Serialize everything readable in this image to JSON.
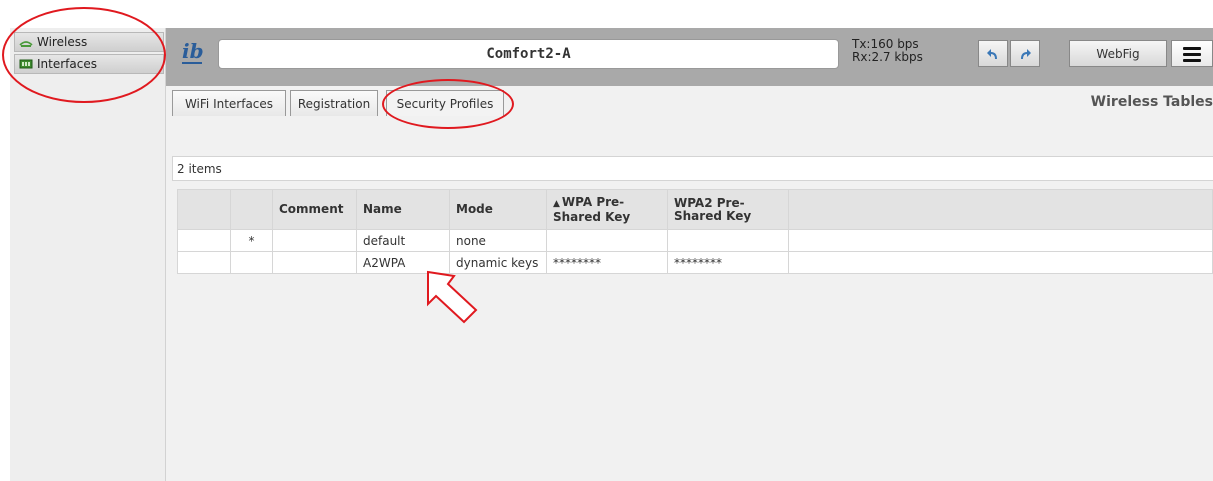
{
  "sidebar": {
    "items": [
      {
        "label": "Wireless",
        "icon": "wifi-icon"
      },
      {
        "label": "Interfaces",
        "icon": "network-card-icon"
      }
    ]
  },
  "header": {
    "title": "Comfort2-A",
    "tx": "Tx:160 bps",
    "rx": "Rx:2.7 kbps",
    "webfig_label": "WebFig",
    "logo_text": "ib"
  },
  "tabs": [
    {
      "label": "WiFi Interfaces"
    },
    {
      "label": "Registration"
    },
    {
      "label": "Security Profiles",
      "active": true
    }
  ],
  "section_title": "Wireless Tables",
  "table": {
    "count_text": "2 items",
    "columns": [
      "",
      "",
      "Comment",
      "Name",
      "Mode",
      "WPA Pre-\nShared Key",
      "WPA2 Pre-\nShared Key",
      ""
    ],
    "rows": [
      [
        "",
        "*",
        "",
        "default",
        "none",
        "",
        "",
        ""
      ],
      [
        "",
        "",
        "",
        "A2WPA",
        "dynamic keys",
        "********",
        "********",
        ""
      ]
    ]
  },
  "colors": {
    "header_bg": "#a9a9a9",
    "annotation_red": "#e0191f",
    "main_bg": "#f1f1f1"
  }
}
